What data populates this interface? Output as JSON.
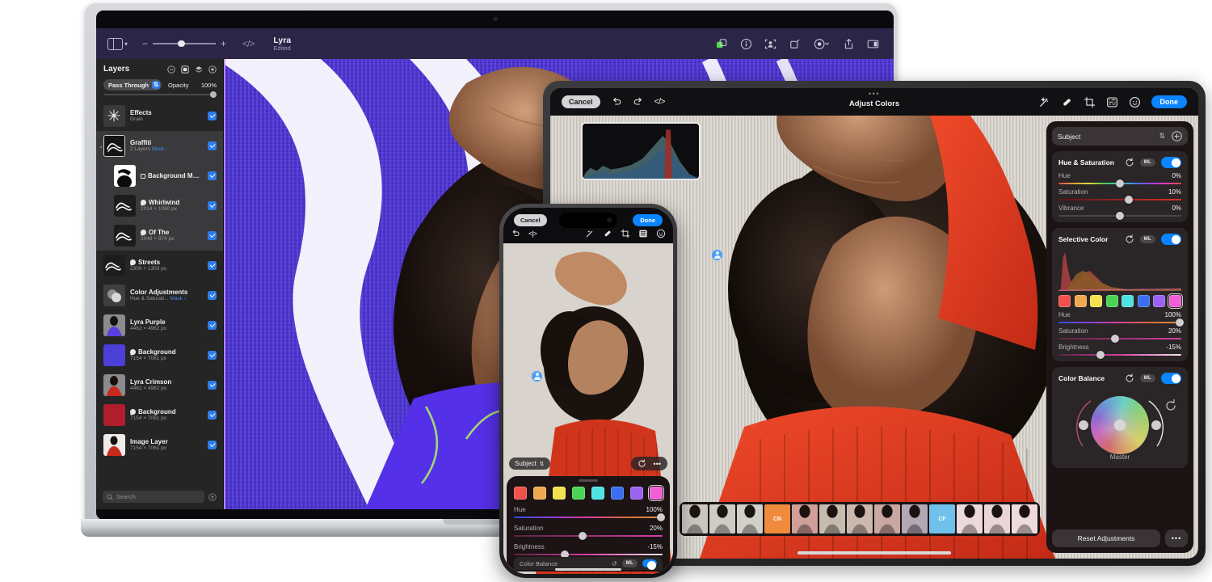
{
  "mac": {
    "toolbar": {
      "sidebar_toggle": "sidebar-toggle",
      "zoom_minus": "−",
      "zoom_plus": "+",
      "code_icon": "</>",
      "doc_title": "Lyra",
      "doc_status": "Edited",
      "right_icons": [
        "layers-add-icon",
        "info-icon",
        "subject-select-icon",
        "transform-icon",
        "adjust-icon",
        "share-icon",
        "panel-icon"
      ]
    },
    "layers": {
      "title": "Layers",
      "head_icons": [
        "minus-circle-icon",
        "mask-square-icon",
        "stack-icon",
        "add-circle-icon"
      ],
      "blend_mode": "Pass Through",
      "opacity_label": "Opacity",
      "opacity_value": "100%",
      "search_placeholder": "Search",
      "items": [
        {
          "name": "Effects",
          "sub": "Grain",
          "kind": "effect",
          "checked": true,
          "selected": false,
          "indent": 0
        },
        {
          "name": "Graffiti",
          "sub": "2 Layers",
          "mask": "Mask",
          "kind": "group",
          "checked": true,
          "selected": true,
          "indent": 0
        },
        {
          "name": "Background Mask",
          "sub": "",
          "kind": "mask",
          "checked": true,
          "selected": true,
          "indent": 1
        },
        {
          "name": "Whirlwind",
          "sub": "2014 × 1060 px",
          "kind": "leaf",
          "checked": true,
          "selected": true,
          "indent": 1
        },
        {
          "name": "Of The",
          "sub": "2048 × 974 px",
          "kind": "leaf",
          "checked": true,
          "selected": true,
          "indent": 1
        },
        {
          "name": "Streets",
          "sub": "2309 × 1303 px",
          "kind": "leaf",
          "checked": true,
          "selected": false,
          "indent": 0
        },
        {
          "name": "Color Adjustments",
          "sub": "Hue & Saturati...",
          "mask": "Mask",
          "kind": "adjust",
          "checked": true,
          "selected": false,
          "indent": 0
        },
        {
          "name": "Lyra Purple",
          "sub": "4462 × 4962 px",
          "kind": "image",
          "checked": true,
          "selected": false,
          "indent": 0
        },
        {
          "name": "Background",
          "sub": "7154 × 7061 px",
          "kind": "leaf",
          "checked": true,
          "selected": false,
          "indent": 0
        },
        {
          "name": "Lyra Crimson",
          "sub": "4462 × 4962 px",
          "kind": "image",
          "checked": true,
          "selected": false,
          "indent": 0
        },
        {
          "name": "Background",
          "sub": "7154 × 7061 px",
          "kind": "leaf",
          "checked": true,
          "selected": false,
          "indent": 0
        },
        {
          "name": "Image Layer",
          "sub": "7154 × 7061 px",
          "kind": "image",
          "checked": true,
          "selected": false,
          "indent": 0
        }
      ]
    }
  },
  "ipad": {
    "toolbar": {
      "cancel": "Cancel",
      "undo_icon": "undo-icon",
      "redo_icon": "redo-icon",
      "code_icon": "</>",
      "dots": "•••",
      "title": "Adjust Colors",
      "right_icons": [
        "magic-wand-icon",
        "retouch-icon",
        "crop-icon",
        "adjust-sliders-icon",
        "filters-icon"
      ],
      "done": "Done"
    },
    "inspector": {
      "subject_label": "Subject",
      "subject_stepper_icon": "stepper-icon",
      "subject_add_icon": "plus-circle-icon",
      "sections": [
        {
          "title": "Hue & Saturation",
          "reset_icon": "reset-icon",
          "ml_badge": "ML",
          "enabled": true,
          "sliders": [
            {
              "name": "Hue",
              "value": "0%",
              "pct": 50,
              "grad": "hue-grad"
            },
            {
              "name": "Saturation",
              "value": "10%",
              "pct": 57,
              "grad": "sat-grad"
            },
            {
              "name": "Vibrance",
              "value": "0%",
              "pct": 50,
              "grad": "plain-grad"
            }
          ]
        },
        {
          "title": "Selective Color",
          "reset_icon": "reset-icon",
          "ml_badge": "ML",
          "enabled": true,
          "swatches": [
            "#f2514b",
            "#f0a84e",
            "#f2e24e",
            "#4ad455",
            "#4fe2e2",
            "#3b6ef0",
            "#9a62f0",
            "#f05fd6"
          ],
          "active_swatch": 7,
          "sliders": [
            {
              "name": "Hue",
              "value": "100%",
              "pct": 99,
              "grad": "hue2-grad"
            },
            {
              "name": "Saturation",
              "value": "20%",
              "pct": 46,
              "grad": "sat2-grad"
            },
            {
              "name": "Brightness",
              "value": "-15%",
              "pct": 34,
              "grad": "bri-grad"
            }
          ]
        },
        {
          "title": "Color Balance",
          "reset_icon": "reset-icon",
          "ml_badge": "ML",
          "enabled": true,
          "wheel_label": "Master"
        }
      ],
      "reset_button": "Reset Adjustments",
      "more_button": "•••"
    },
    "filmstrip": [
      {
        "label": "",
        "tone": "#c9c6c0"
      },
      {
        "label": "",
        "tone": "#cfccc6"
      },
      {
        "label": "",
        "tone": "#d3d0ca"
      },
      {
        "label": "CN",
        "tone": "#f08a3c"
      },
      {
        "label": "",
        "tone": "#cf9f98"
      },
      {
        "label": "",
        "tone": "#c5bcae"
      },
      {
        "label": "",
        "tone": "#cdb8ae"
      },
      {
        "label": "",
        "tone": "#c9a7a3"
      },
      {
        "label": "",
        "tone": "#b2a8b4"
      },
      {
        "label": "CF",
        "tone": "#6fc0ea"
      },
      {
        "label": "",
        "tone": "#ecd9dd"
      },
      {
        "label": "",
        "tone": "#e9d4d8"
      },
      {
        "label": "",
        "tone": "#efdade"
      }
    ]
  },
  "iphone": {
    "cancel": "Cancel",
    "done": "Done",
    "tool_icons": [
      "undo-icon",
      "code-icon",
      "magic-wand-icon",
      "retouch-icon",
      "crop-icon",
      "adjust-sliders-icon",
      "filters-icon"
    ],
    "subject_label": "Subject",
    "reset_icon": "reset-icon",
    "more_icon": "•••",
    "swatches": [
      "#f2514b",
      "#f0a84e",
      "#f2e24e",
      "#4ad455",
      "#4fe2e2",
      "#3b6ef0",
      "#9a62f0",
      "#f05fd6"
    ],
    "active_swatch": 7,
    "sliders": [
      {
        "name": "Hue",
        "value": "100%",
        "pct": 99,
        "grad": "hue2-grad"
      },
      {
        "name": "Saturation",
        "value": "20%",
        "pct": 46,
        "grad": "sat2-grad"
      },
      {
        "name": "Brightness",
        "value": "-15%",
        "pct": 34,
        "grad": "bri-grad"
      }
    ],
    "next_section": "Color Balance"
  }
}
